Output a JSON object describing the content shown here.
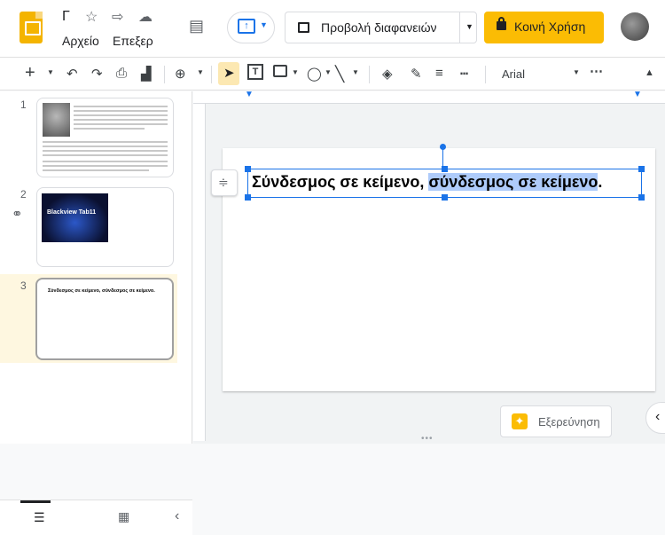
{
  "header": {
    "doc_title_truncated": "Γ",
    "menu": [
      "Αρχείο",
      "Επεξερ"
    ],
    "present_label": "Προβολή διαφανειών",
    "share_label": "Κοινή Χρήση"
  },
  "toolbar": {
    "font_name": "Arial"
  },
  "filmstrip": {
    "slides": [
      {
        "number": "1"
      },
      {
        "number": "2",
        "image_text": "Blackview Tab11"
      },
      {
        "number": "3",
        "text": "Σύνδεσμος σε κείμενο, σύνδεσμος σε κείμενο."
      }
    ]
  },
  "slide": {
    "text_plain": "Σύνδεσμος σε κείμενο, ",
    "text_selected": "σύνδεσμος σε κείμενο",
    "text_end": "."
  },
  "explore": {
    "label": "Εξερεύνηση"
  },
  "colors": {
    "accent": "#1a73e8",
    "share": "#fbbc04",
    "selection": "#aecbfa"
  }
}
